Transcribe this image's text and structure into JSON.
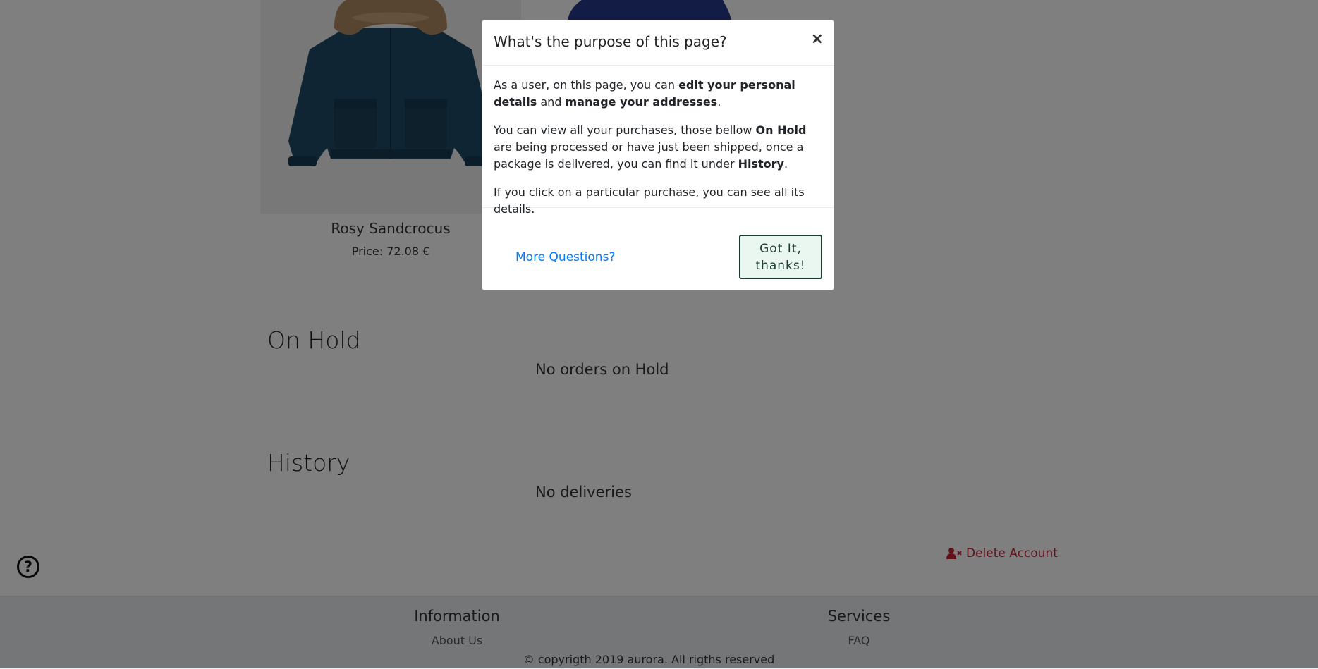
{
  "products": [
    {
      "name": "Rosy Sandcrocus",
      "price": "Price: 72.08 €"
    }
  ],
  "sections": {
    "on_hold": {
      "title": "On Hold",
      "empty": "No orders on Hold"
    },
    "history": {
      "title": "History",
      "empty": "No deliveries"
    }
  },
  "delete_account": "Delete Account",
  "help_icon": "?",
  "footer": {
    "information": {
      "title": "Information",
      "link": "About Us"
    },
    "services": {
      "title": "Services",
      "link": "FAQ"
    },
    "copyright": "copyrigth 2019 aurora. All rigths reserved"
  },
  "modal": {
    "title": "What's the purpose of this page?",
    "close": "×",
    "p1_a": "As a user, on this page, you can ",
    "p1_b": "edit your personal details",
    "p1_c": " and ",
    "p1_d": "manage your addresses",
    "p1_e": ".",
    "p2_a": "You can view all your purchases, those bellow ",
    "p2_b": "On Hold",
    "p2_c": " are being processed or have just been shipped, once a package is delivered, you can find it under ",
    "p2_d": "History",
    "p2_e": ".",
    "p3": "If you click on a particular purchase, you can see all its details.",
    "more_questions": "More Questions?",
    "got_it": "Got It, thanks!"
  },
  "colors": {
    "danger": "#c82333",
    "link": "#007bff",
    "button_border": "#1d3c34"
  }
}
